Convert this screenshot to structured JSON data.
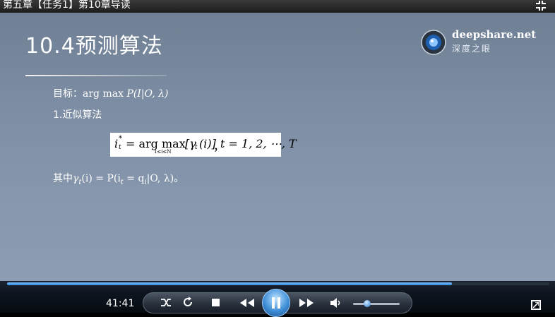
{
  "window": {
    "title": "第五章【任务1】第10章导读"
  },
  "slide": {
    "title": "10.4预测算法",
    "logo": {
      "brand": "deepshare.net",
      "tagline": "深度之眼"
    },
    "goal": {
      "label": "目标：",
      "expr_op": "arg max ",
      "expr": "P(I|O, λ)"
    },
    "approx": "1.近似算法",
    "formula": {
      "lhs": "i",
      "sub_t": "t",
      "sup": "*",
      "eq": "= arg max",
      "limits": "1≤i≤N",
      "bracket": "[γ",
      "gamma_sub": "t",
      "arg": "(i)]",
      "comma": "，",
      "range": "t = 1, 2, ⋯, T"
    },
    "where": {
      "prefix": "其中",
      "gamma": "γ",
      "gamma_sub": "t",
      "middle": "(i) = P(i",
      "i_sub": "t",
      "mid2": " = q",
      "q_sub": "i",
      "end": "|O, λ)。"
    }
  },
  "player": {
    "time": "41:41",
    "progress": 0.82,
    "volume": 0.3,
    "icons": [
      "shuffle-icon",
      "repeat-icon",
      "stop-icon",
      "rewind-icon",
      "pause-icon",
      "forward-icon",
      "volume-icon",
      "fullscreen-icon"
    ]
  }
}
